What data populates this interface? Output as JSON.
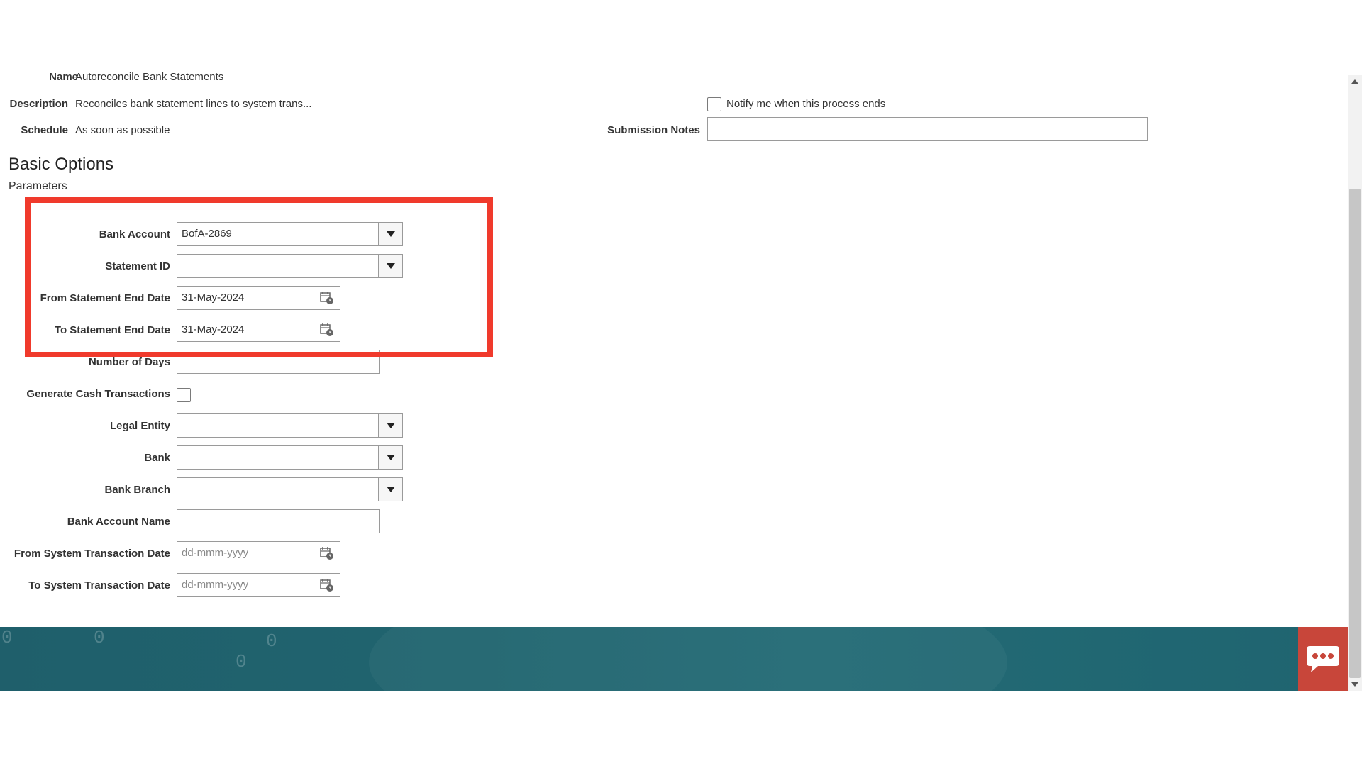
{
  "header": {
    "name_label": "Name",
    "name_value": "Autoreconcile Bank Statements",
    "description_label": "Description",
    "description_value": "Reconciles bank statement lines to system trans...",
    "schedule_label": "Schedule",
    "schedule_value": "As soon as possible",
    "notify_label": "Notify me when this process ends",
    "submission_notes_label": "Submission Notes",
    "submission_notes_value": ""
  },
  "section": {
    "title": "Basic Options",
    "subtitle": "Parameters"
  },
  "params": {
    "bank_account_label": "Bank Account",
    "bank_account_value": "BofA-2869",
    "statement_id_label": "Statement ID",
    "statement_id_value": "",
    "from_stmt_end_label": "From Statement End Date",
    "from_stmt_end_value": "31-May-2024",
    "to_stmt_end_label": "To Statement End Date",
    "to_stmt_end_value": "31-May-2024",
    "num_days_label": "Number of Days",
    "num_days_value": "",
    "gen_cash_label": "Generate Cash Transactions",
    "legal_entity_label": "Legal Entity",
    "bank_label": "Bank",
    "bank_branch_label": "Bank Branch",
    "bank_account_name_label": "Bank Account Name",
    "from_sys_txn_label": "From System Transaction Date",
    "from_sys_txn_placeholder": "dd-mmm-yyyy",
    "to_sys_txn_label": "To System Transaction Date",
    "to_sys_txn_placeholder": "dd-mmm-yyyy"
  },
  "colors": {
    "highlight": "#f03a2c",
    "footer": "#20646f",
    "chat_button": "#c8463a"
  },
  "icons": {
    "calendar": "calendar-icon",
    "dropdown": "chevron-down-icon",
    "chat": "chat-icon"
  }
}
